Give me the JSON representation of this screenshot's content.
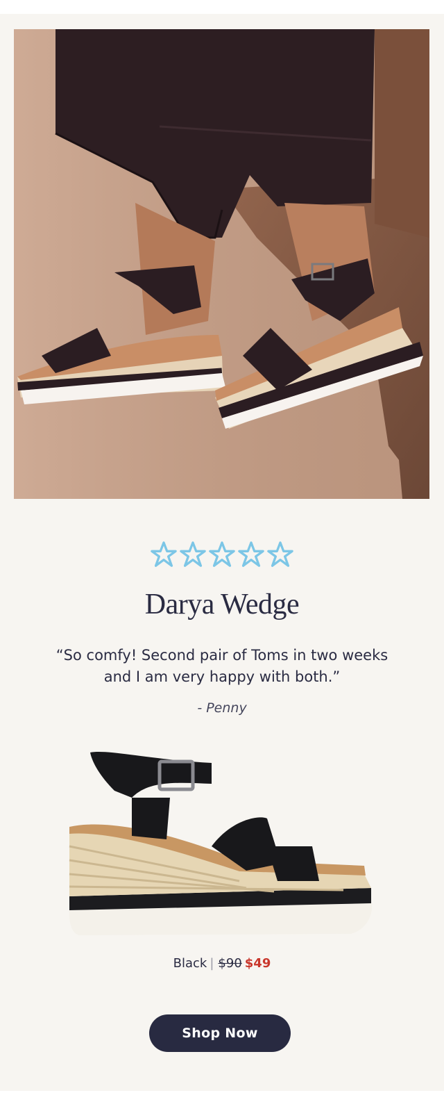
{
  "hero": {
    "image": "product-lifestyle-photo",
    "alt_subject": "wedge sandals worn, seated against carved wood"
  },
  "rating": {
    "stars": 5,
    "max": 5,
    "star_color": "#7cc6e6"
  },
  "product": {
    "name": "Darya Wedge",
    "image": "darya-wedge-product-image",
    "color_name": "Black",
    "original_price": "$90",
    "sale_price": "$49",
    "separator": "|"
  },
  "review": {
    "quote": "“So comfy! Second pair of Toms in two weeks and I am very happy with both.”",
    "author": "- Penny"
  },
  "cta": {
    "label": "Shop Now"
  },
  "colors": {
    "background": "#f7f5f1",
    "text": "#2a2b42",
    "sale": "#c9372c",
    "button": "#282a41"
  }
}
